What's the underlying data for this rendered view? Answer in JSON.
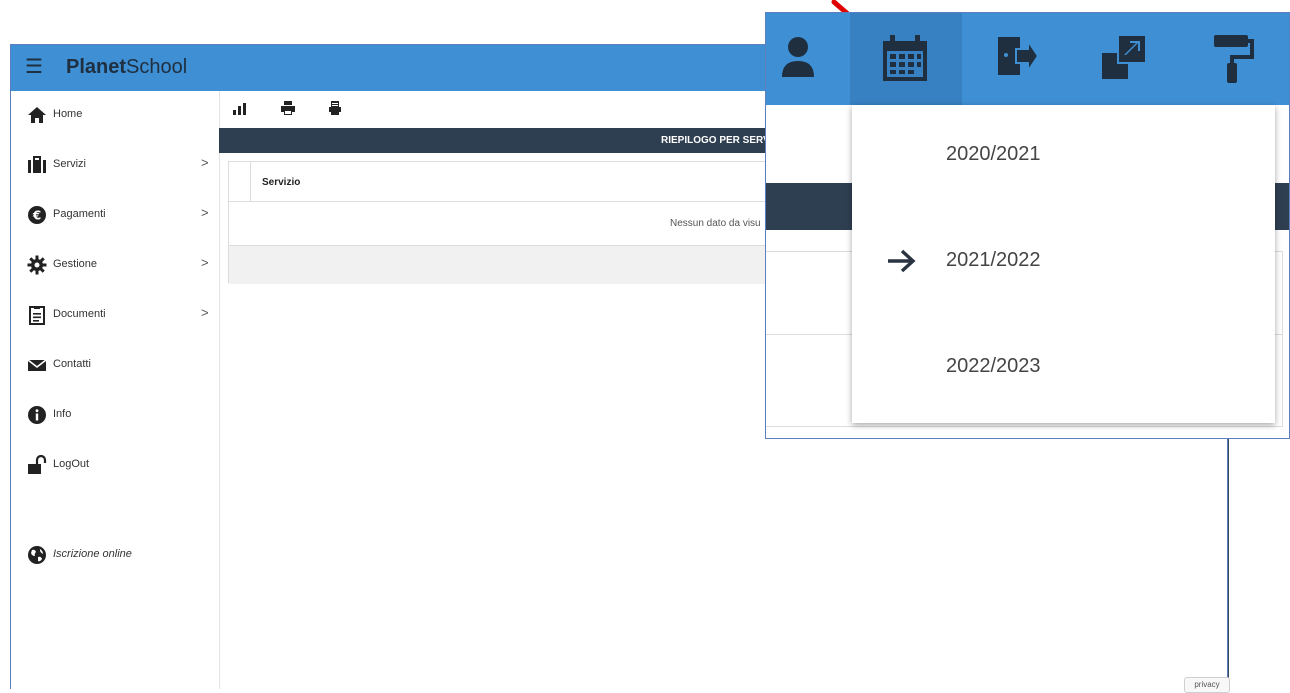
{
  "app": {
    "brand_bold": "Planet",
    "brand_light": "School"
  },
  "sidebar": {
    "items": [
      {
        "label": "Home",
        "icon": "home-icon"
      },
      {
        "label": "Servizi",
        "icon": "briefcase-icon",
        "chevron": ">"
      },
      {
        "label": "Pagamenti",
        "icon": "euro-icon",
        "chevron": ">"
      },
      {
        "label": "Gestione",
        "icon": "gear-icon",
        "chevron": ">"
      },
      {
        "label": "Documenti",
        "icon": "clipboard-icon",
        "chevron": ">"
      },
      {
        "label": "Contatti",
        "icon": "envelope-icon"
      },
      {
        "label": "Info",
        "icon": "info-icon"
      },
      {
        "label": "LogOut",
        "icon": "unlock-icon"
      },
      {
        "label": "Iscrizione online",
        "icon": "globe-icon"
      }
    ]
  },
  "toolbar": {
    "icons": [
      "bar-chart-icon",
      "print-icon",
      "document-print-icon"
    ]
  },
  "report": {
    "header": "RIEPILOGO PER SERV",
    "column": "Servizio",
    "empty": "Nessun dato da visu"
  },
  "privacy": "privacy",
  "inset": {
    "icons": [
      "user-icon",
      "calendar-icon",
      "exit-icon",
      "resize-icon",
      "paint-roller-icon"
    ],
    "menu": [
      {
        "label": "2020/2021",
        "selected": false
      },
      {
        "label": "2021/2022",
        "selected": true
      },
      {
        "label": "2022/2023",
        "selected": false
      }
    ]
  },
  "colors": {
    "topbar": "#3e8fd4",
    "dark_header": "#2f3f52",
    "annotation_arrow": "#e00000"
  }
}
